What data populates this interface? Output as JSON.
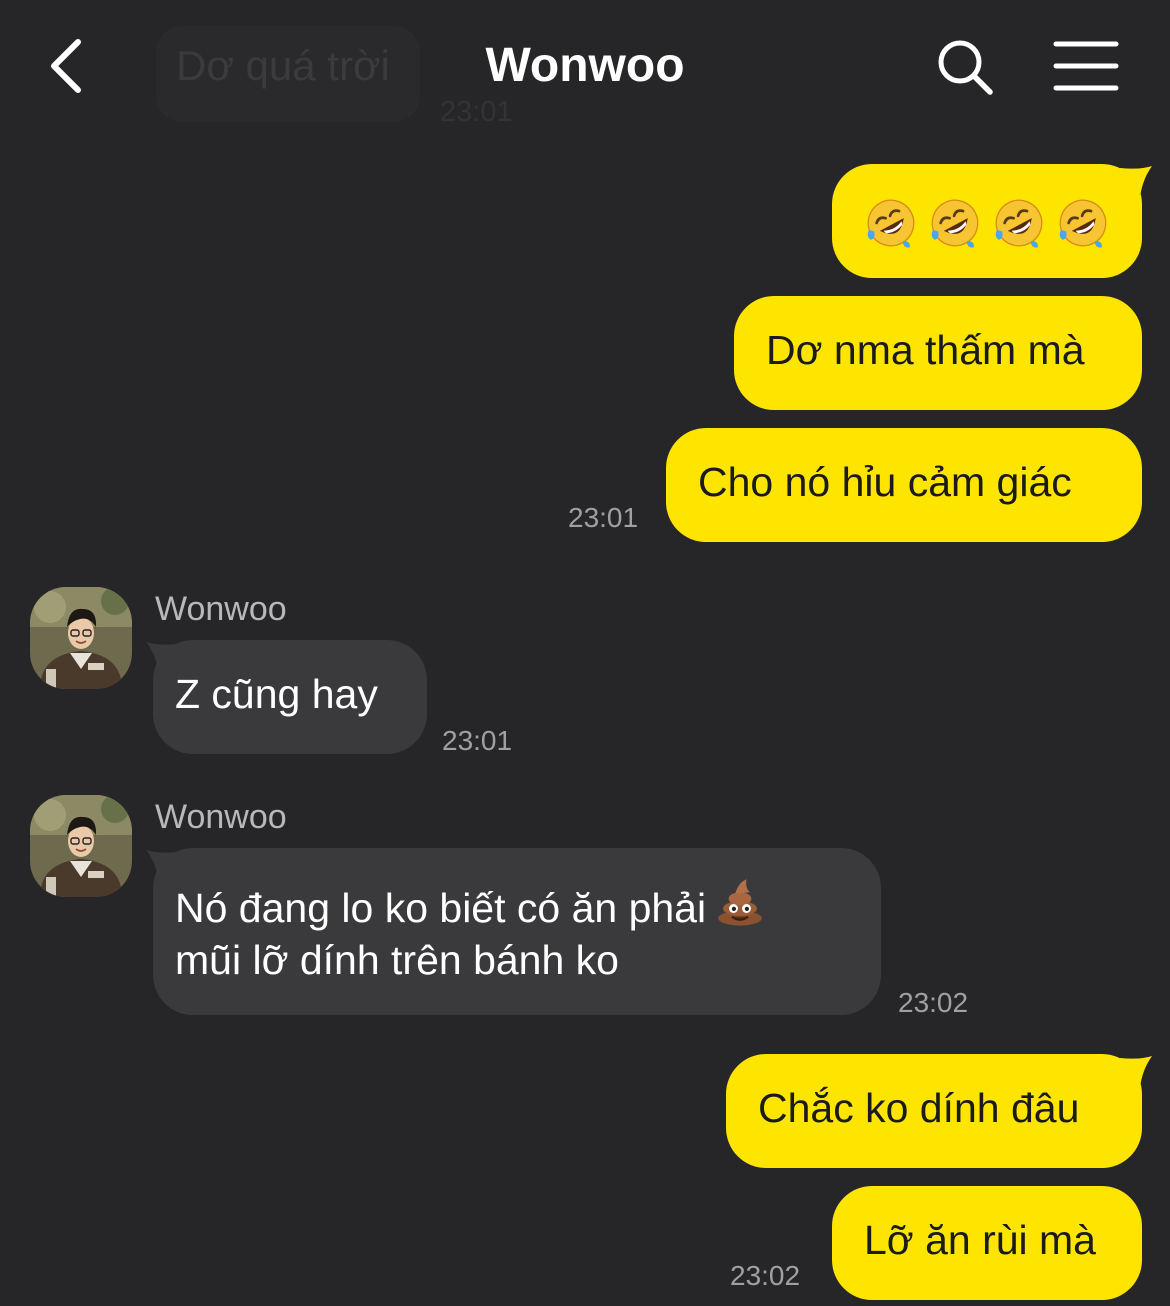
{
  "header": {
    "title": "Wonwoo",
    "back_icon": "chevron-left-icon",
    "search_icon": "search-icon",
    "menu_icon": "hamburger-menu-icon",
    "faded_message": "Dơ quá trời",
    "faded_time": "23:01"
  },
  "colors": {
    "background": "#262628",
    "outgoing_bubble": "#fee500",
    "incoming_bubble": "#3a3a3c",
    "timestamp": "#a0a0a4"
  },
  "messages": [
    {
      "direction": "out",
      "emoji": [
        "rolling-on-floor-laughing-emoji",
        "rolling-on-floor-laughing-emoji",
        "rolling-on-floor-laughing-emoji",
        "rolling-on-floor-laughing-emoji"
      ]
    },
    {
      "direction": "out",
      "text": "Dơ nma thấm mà"
    },
    {
      "direction": "out",
      "text": "Cho nó hỉu cảm giác",
      "time": "23:01"
    },
    {
      "direction": "in",
      "sender": "Wonwoo",
      "text": "Z cũng hay",
      "time": "23:01"
    },
    {
      "direction": "in",
      "sender": "Wonwoo",
      "lines": [
        "Nó đang lo ko biết có ăn phải",
        "mũi lỡ dính trên bánh ko"
      ],
      "emoji": "pile-of-poo-emoji",
      "time": "23:02"
    },
    {
      "direction": "out",
      "text": "Chắc ko dính đâu"
    },
    {
      "direction": "out",
      "text": "Lỡ ăn rùi mà",
      "time": "23:02"
    }
  ]
}
